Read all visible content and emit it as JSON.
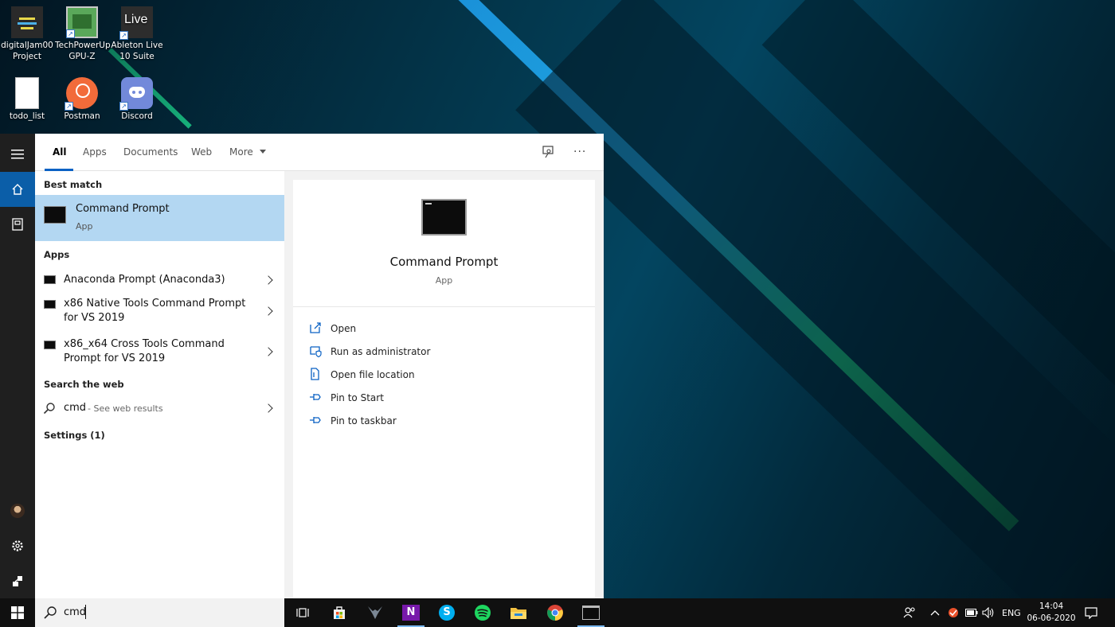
{
  "desktop": {
    "icons": [
      {
        "label_l1": "digitalJam00",
        "label_l2": "Project",
        "icon": "folder-project-icon"
      },
      {
        "label_l1": "TechPowerUp",
        "label_l2": "GPU-Z",
        "icon": "gpuz-icon"
      },
      {
        "label_l1": "Ableton Live",
        "label_l2": "10 Suite",
        "icon": "ableton-icon",
        "logo_text": "Live"
      },
      {
        "label_l1": "todo_list",
        "label_l2": "",
        "icon": "text-file-icon"
      },
      {
        "label_l1": "Postman",
        "label_l2": "",
        "icon": "postman-icon"
      },
      {
        "label_l1": "Discord",
        "label_l2": "",
        "icon": "discord-icon"
      }
    ]
  },
  "start_rail": {
    "items": [
      "hamburger-icon",
      "home-icon",
      "documents-icon",
      "user-avatar",
      "settings-icon",
      "feedback-icon"
    ]
  },
  "search": {
    "tabs": [
      {
        "label": "All",
        "active": true
      },
      {
        "label": "Apps"
      },
      {
        "label": "Documents"
      },
      {
        "label": "Web"
      },
      {
        "label": "More"
      }
    ],
    "best_match_heading": "Best match",
    "best_match": {
      "title": "Command Prompt",
      "subtitle": "App"
    },
    "apps_heading": "Apps",
    "apps": [
      {
        "line1": "Anaconda Prompt (Anaconda3)",
        "line2": ""
      },
      {
        "line1": "x86 Native Tools Command Prompt",
        "line2": "for VS 2019"
      },
      {
        "line1": "x86_x64 Cross Tools Command",
        "line2": "Prompt for VS 2019"
      }
    ],
    "web_heading": "Search the web",
    "web_query": "cmd",
    "web_suffix": " - See web results",
    "settings_heading": "Settings (1)",
    "query": "cmd"
  },
  "detail": {
    "title": "Command Prompt",
    "subtitle": "App",
    "actions": [
      {
        "label": "Open",
        "icon": "open-icon"
      },
      {
        "label": "Run as administrator",
        "icon": "shield-run-icon"
      },
      {
        "label": "Open file location",
        "icon": "file-location-icon"
      },
      {
        "label": "Pin to Start",
        "icon": "pin-start-icon"
      },
      {
        "label": "Pin to taskbar",
        "icon": "pin-taskbar-icon"
      }
    ]
  },
  "taskbar": {
    "language": "ENG",
    "time": "14:04",
    "date": "06-06-2020"
  },
  "colors": {
    "accent": "#0b62c4",
    "selected_row": "#b3d7f2",
    "taskbar": "#101010"
  }
}
